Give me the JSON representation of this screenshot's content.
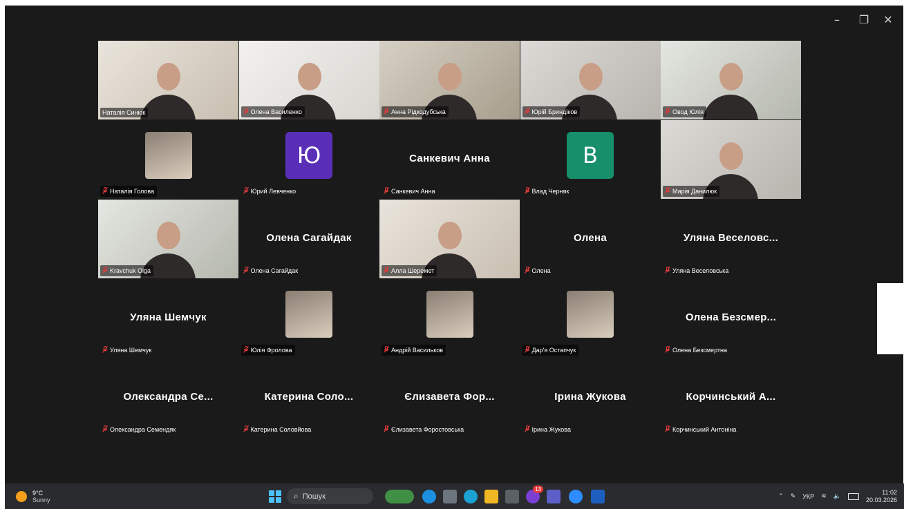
{
  "window": {
    "minimize": "–",
    "restore": "❐",
    "close": "✕"
  },
  "participants": [
    {
      "name": "Наталія Синюк",
      "type": "video",
      "active": true,
      "muted": false
    },
    {
      "name": "Олена Василенко",
      "type": "video",
      "muted": true
    },
    {
      "name": "Анна Рідкодубська",
      "type": "video",
      "muted": true
    },
    {
      "name": "Юрій Бриндіков",
      "type": "video",
      "muted": true
    },
    {
      "name": "Овод Юлія",
      "type": "video",
      "muted": true
    },
    {
      "name": "Наталія Голова",
      "type": "photo",
      "muted": true
    },
    {
      "name": "Юрий Левченко",
      "type": "initial",
      "initial": "Ю",
      "color": "#5a2fb8",
      "muted": true
    },
    {
      "name": "Санкевич Анна",
      "type": "text",
      "display": "Санкевич Анна",
      "muted": true
    },
    {
      "name": "Влад Черняк",
      "type": "initial",
      "initial": "В",
      "color": "#178f6a",
      "muted": true
    },
    {
      "name": "Марія Данилюк",
      "type": "video",
      "muted": true
    },
    {
      "name": "Kravchuk Olga",
      "type": "video",
      "muted": true
    },
    {
      "name": "Олена Сагайдак",
      "type": "text",
      "display": "Олена Сагайдак",
      "muted": true
    },
    {
      "name": "Алла Шеремет",
      "type": "video",
      "muted": true
    },
    {
      "name": "Олена",
      "type": "text",
      "display": "Олена",
      "muted": true
    },
    {
      "name": "Уляна Веселовська",
      "type": "text",
      "display": "Уляна Веселовс...",
      "muted": true
    },
    {
      "name": "Уляна Шемчук",
      "type": "text",
      "display": "Уляна Шемчук",
      "muted": true
    },
    {
      "name": "Юлія Фролова",
      "type": "photo",
      "muted": true
    },
    {
      "name": "Андрій Васильков",
      "type": "photo",
      "muted": true
    },
    {
      "name": "Дар'я Остапчук",
      "type": "photo",
      "muted": true
    },
    {
      "name": "Олена Безсмертна",
      "type": "text",
      "display": "Олена Безсмер...",
      "muted": true
    },
    {
      "name": "Олександра Семендяк",
      "type": "text",
      "display": "Олександра Се...",
      "muted": true
    },
    {
      "name": "Катерина Соловйова",
      "type": "text",
      "display": "Катерина Соло...",
      "muted": true
    },
    {
      "name": "Єлизавета Форостовська",
      "type": "text",
      "display": "Єлизавета Фор...",
      "muted": true
    },
    {
      "name": "Ірина Жукова",
      "type": "text",
      "display": "Ірина Жукова",
      "muted": true
    },
    {
      "name": "Корчинський Антоніна",
      "type": "text",
      "display": "Корчинський А...",
      "muted": true
    }
  ],
  "taskbar": {
    "weather": {
      "temp": "9°C",
      "condition": "Sunny"
    },
    "search_placeholder": "Пошук",
    "notification_badge": "13",
    "tray": {
      "lang": "УКР",
      "time": "11:02",
      "date": "20.03.2026"
    }
  },
  "colors": {
    "active_border": "#2ed573",
    "bg": "#1a1a1a",
    "mic_muted": "#e03b3b"
  }
}
